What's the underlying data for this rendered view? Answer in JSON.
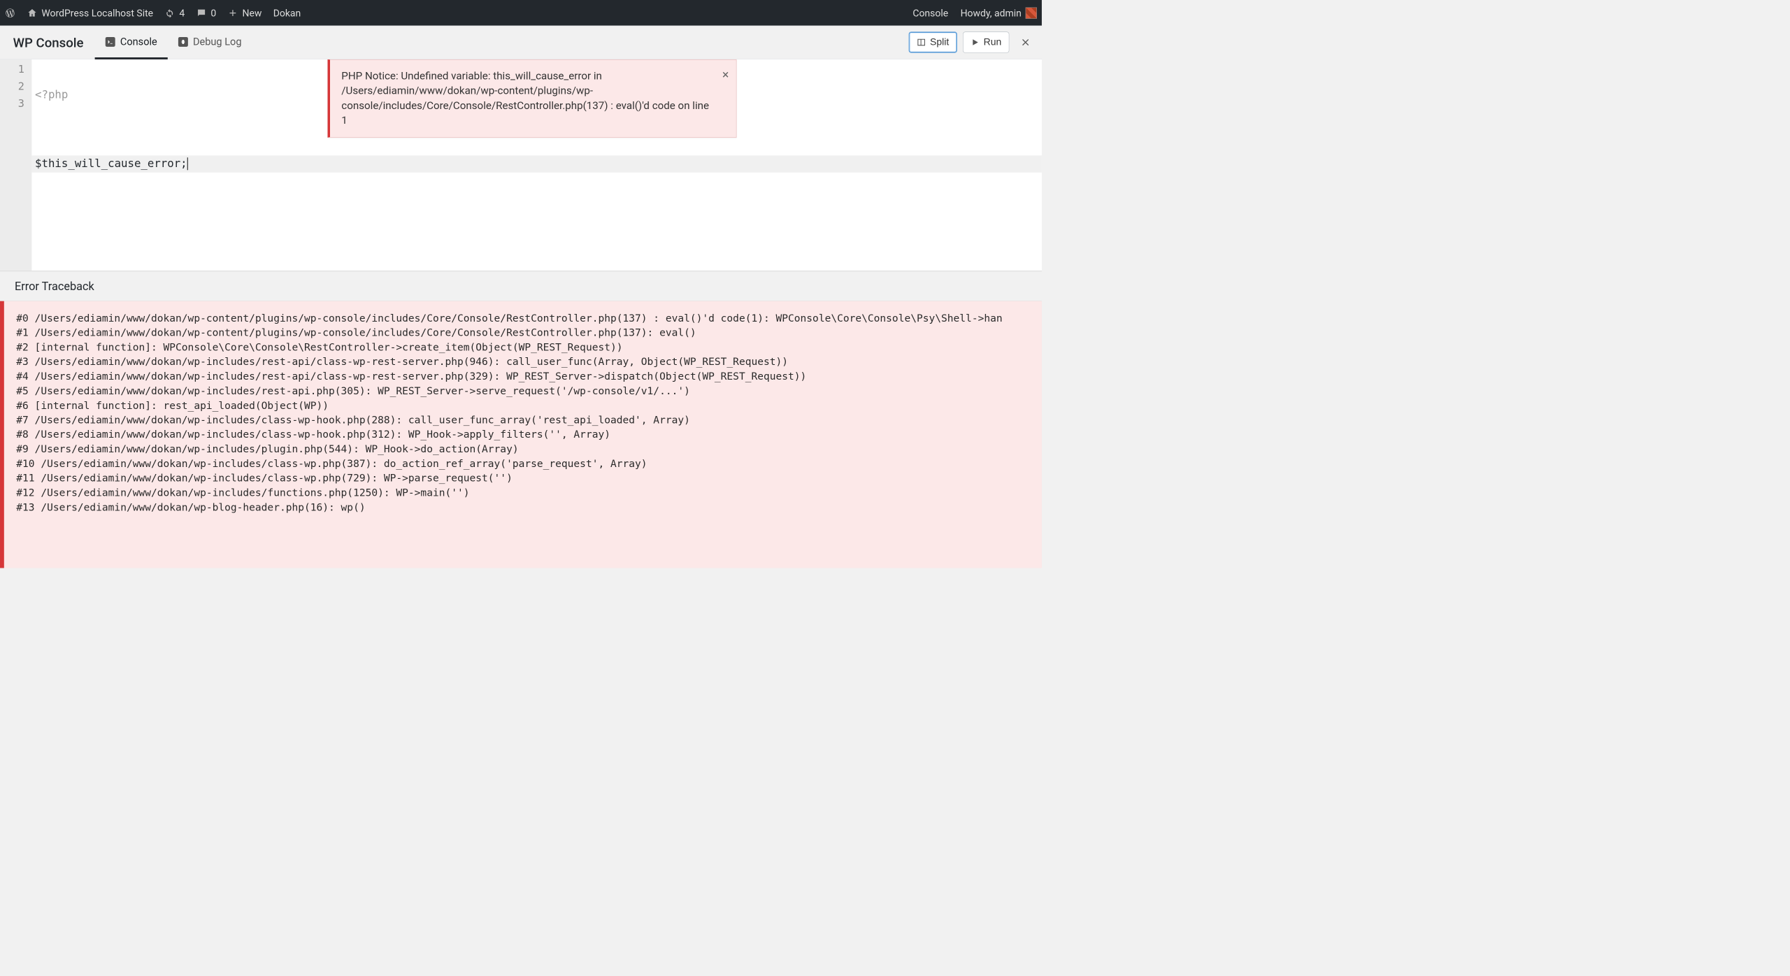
{
  "adminbar": {
    "site_name": "WordPress Localhost Site",
    "refresh_count": "4",
    "comments_count": "0",
    "new_label": "New",
    "extra_item": "Dokan",
    "console_link": "Console",
    "howdy_prefix": "Howdy, ",
    "user_name": "admin"
  },
  "panel": {
    "title": "WP Console",
    "tabs": {
      "console": "Console",
      "debug_log": "Debug Log"
    },
    "buttons": {
      "split": "Split",
      "run": "Run"
    }
  },
  "editor": {
    "line_numbers": [
      "1",
      "2",
      "3"
    ],
    "line1": "<?php",
    "line2": "",
    "line3": "$this_will_cause_error;"
  },
  "notice": {
    "text": "PHP Notice: Undefined variable: this_will_cause_error in /Users/ediamin/www/dokan/wp-content/plugins/wp-console/includes/Core/Console/RestController.php(137) : eval()'d code on line 1"
  },
  "traceback": {
    "title": "Error Traceback",
    "lines": [
      "#0 /Users/ediamin/www/dokan/wp-content/plugins/wp-console/includes/Core/Console/RestController.php(137) : eval()'d code(1): WPConsole\\Core\\Console\\Psy\\Shell->han",
      "#1 /Users/ediamin/www/dokan/wp-content/plugins/wp-console/includes/Core/Console/RestController.php(137): eval()",
      "#2 [internal function]: WPConsole\\Core\\Console\\RestController->create_item(Object(WP_REST_Request))",
      "#3 /Users/ediamin/www/dokan/wp-includes/rest-api/class-wp-rest-server.php(946): call_user_func(Array, Object(WP_REST_Request))",
      "#4 /Users/ediamin/www/dokan/wp-includes/rest-api/class-wp-rest-server.php(329): WP_REST_Server->dispatch(Object(WP_REST_Request))",
      "#5 /Users/ediamin/www/dokan/wp-includes/rest-api.php(305): WP_REST_Server->serve_request('/wp-console/v1/...')",
      "#6 [internal function]: rest_api_loaded(Object(WP))",
      "#7 /Users/ediamin/www/dokan/wp-includes/class-wp-hook.php(288): call_user_func_array('rest_api_loaded', Array)",
      "#8 /Users/ediamin/www/dokan/wp-includes/class-wp-hook.php(312): WP_Hook->apply_filters('', Array)",
      "#9 /Users/ediamin/www/dokan/wp-includes/plugin.php(544): WP_Hook->do_action(Array)",
      "#10 /Users/ediamin/www/dokan/wp-includes/class-wp.php(387): do_action_ref_array('parse_request', Array)",
      "#11 /Users/ediamin/www/dokan/wp-includes/class-wp.php(729): WP->parse_request('')",
      "#12 /Users/ediamin/www/dokan/wp-includes/functions.php(1250): WP->main('')",
      "#13 /Users/ediamin/www/dokan/wp-blog-header.php(16): wp()"
    ]
  }
}
